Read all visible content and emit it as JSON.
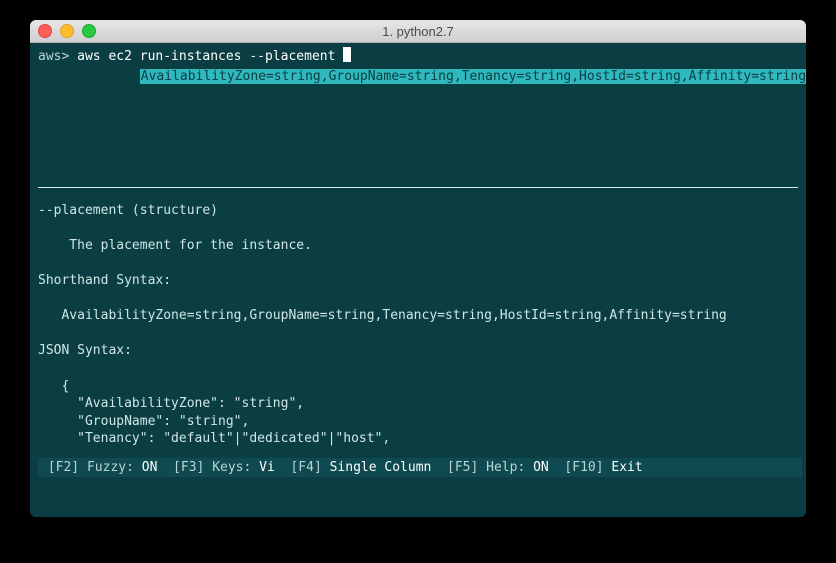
{
  "window": {
    "title": "1. python2.7"
  },
  "prompt": {
    "label": "aws>",
    "command": "aws ec2 run-instances --placement "
  },
  "suggestion": {
    "indent": "             ",
    "text": "AvailabilityZone=string,GroupName=string,Tenancy=string,HostId=string,Affinity=string"
  },
  "help": {
    "header": "--placement (structure)",
    "description": "    The placement for the instance.",
    "shorthand_label": "Shorthand Syntax:",
    "shorthand_value": "   AvailabilityZone=string,GroupName=string,Tenancy=string,HostId=string,Affinity=string",
    "json_label": "JSON Syntax:",
    "json_lines": [
      "   {",
      "     \"AvailabilityZone\": \"string\",",
      "     \"GroupName\": \"string\",",
      "     \"Tenancy\": \"default\"|\"dedicated\"|\"host\","
    ]
  },
  "status": {
    "f2_label": " [F2] Fuzzy: ",
    "f2_value": "ON",
    "f3_label": "  [F3] Keys: ",
    "f3_value": "Vi",
    "f4_label": "  [F4] ",
    "f4_value": "Single Column",
    "f5_label": "  [F5] Help: ",
    "f5_value": "ON",
    "f10_label": "  [F10] ",
    "f10_value": "Exit"
  }
}
